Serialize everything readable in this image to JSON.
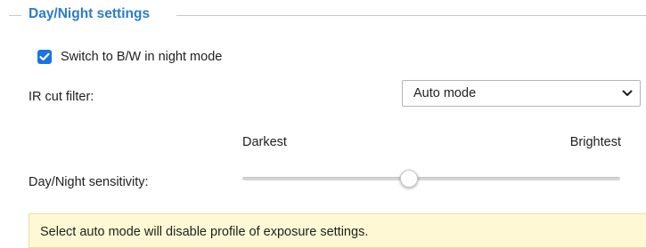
{
  "section": {
    "title": "Day/Night settings"
  },
  "bw_switch": {
    "label": "Switch to B/W in night mode",
    "checked": true
  },
  "ir_cut_filter": {
    "label": "IR cut filter:",
    "selected": "Auto mode"
  },
  "sensitivity": {
    "label": "Day/Night sensitivity:",
    "min_label": "Darkest",
    "max_label": "Brightest",
    "value_fraction": 0.44
  },
  "notice": {
    "text": "Select auto mode will disable profile of exposure settings."
  },
  "colors": {
    "accent": "#2b7bc8",
    "checkbox": "#1a73e8",
    "notice_bg": "#fef9d4"
  },
  "icons": {
    "checkbox_mark": "check-icon",
    "select_arrow": "chevron-down-icon"
  }
}
